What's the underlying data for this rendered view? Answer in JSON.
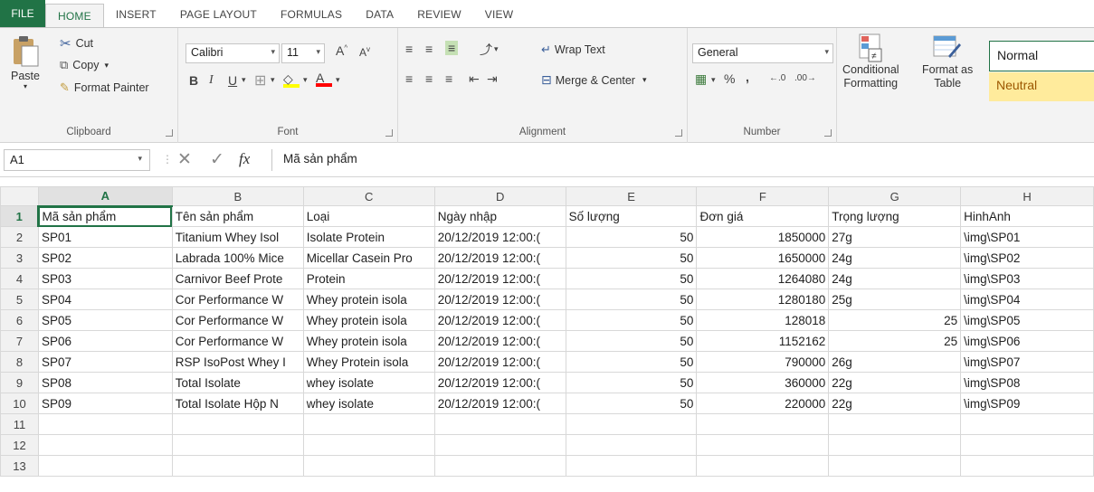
{
  "tabs": [
    "FILE",
    "HOME",
    "INSERT",
    "PAGE LAYOUT",
    "FORMULAS",
    "DATA",
    "REVIEW",
    "VIEW"
  ],
  "clipboard": {
    "paste": "Paste",
    "cut": "Cut",
    "copy": "Copy",
    "format_painter": "Format Painter",
    "label": "Clipboard"
  },
  "font": {
    "name": "Calibri",
    "size": "11",
    "bold": "B",
    "italic": "I",
    "underline": "U",
    "label": "Font"
  },
  "alignment": {
    "wrap": "Wrap Text",
    "merge": "Merge & Center",
    "label": "Alignment"
  },
  "number": {
    "format": "General",
    "percent": "%",
    "comma": ",",
    "label": "Number"
  },
  "styles": {
    "conditional_1": "Conditional",
    "conditional_2": "Formatting",
    "format_as_1": "Format as",
    "format_as_2": "Table",
    "normal": "Normal",
    "neutral": "Neutral"
  },
  "formula_bar": {
    "name_box": "A1",
    "fx": "fx",
    "content": "Mã sản phẩm"
  },
  "columns": [
    "A",
    "B",
    "C",
    "D",
    "E",
    "F",
    "G",
    "H"
  ],
  "rows": [
    {
      "n": "1",
      "cells": [
        "Mã sản phẩm",
        "Tên sản phẩm",
        "Loại",
        "Ngày nhập",
        "Số lượng",
        "Đơn giá",
        "Trọng lượng",
        "HinhAnh"
      ]
    },
    {
      "n": "2",
      "cells": [
        "SP01",
        "Titanium Whey Isol",
        "Isolate Protein",
        "20/12/2019 12:00:(",
        "50",
        "1850000",
        "27g",
        "\\img\\SP01"
      ]
    },
    {
      "n": "3",
      "cells": [
        "SP02",
        "Labrada 100% Mice",
        "Micellar Casein Pro",
        "20/12/2019 12:00:(",
        "50",
        "1650000",
        "24g",
        "\\img\\SP02"
      ]
    },
    {
      "n": "4",
      "cells": [
        "SP03",
        "Carnivor Beef Prote",
        "Protein",
        "20/12/2019 12:00:(",
        "50",
        "1264080",
        "24g",
        "\\img\\SP03"
      ]
    },
    {
      "n": "5",
      "cells": [
        "SP04",
        "Cor Performance W",
        "Whey protein isola",
        "20/12/2019 12:00:(",
        "50",
        "1280180",
        "25g",
        "\\img\\SP04"
      ]
    },
    {
      "n": "6",
      "cells": [
        "SP05",
        "Cor Performance W",
        "Whey protein isola",
        "20/12/2019 12:00:(",
        "50",
        "128018",
        "25",
        "\\img\\SP05"
      ]
    },
    {
      "n": "7",
      "cells": [
        "SP06",
        "Cor Performance W",
        "Whey protein isola",
        "20/12/2019 12:00:(",
        "50",
        "1152162",
        "25",
        "\\img\\SP06"
      ]
    },
    {
      "n": "8",
      "cells": [
        "SP07",
        "RSP IsoPost Whey I",
        "Whey Protein isola",
        "20/12/2019 12:00:(",
        "50",
        "790000",
        "26g",
        "\\img\\SP07"
      ]
    },
    {
      "n": "9",
      "cells": [
        "SP08",
        "Total Isolate",
        "whey isolate",
        "20/12/2019 12:00:(",
        "50",
        "360000",
        "22g",
        "\\img\\SP08"
      ]
    },
    {
      "n": "10",
      "cells": [
        "SP09",
        "Total Isolate Hộp N",
        "whey isolate",
        "20/12/2019 12:00:(",
        "50",
        "220000",
        "22g",
        "\\img\\SP09"
      ]
    },
    {
      "n": "11",
      "cells": [
        "",
        "",
        "",
        "",
        "",
        "",
        "",
        ""
      ]
    },
    {
      "n": "12",
      "cells": [
        "",
        "",
        "",
        "",
        "",
        "",
        "",
        ""
      ]
    },
    {
      "n": "13",
      "cells": [
        "",
        "",
        "",
        "",
        "",
        "",
        "",
        ""
      ]
    }
  ],
  "colors": {
    "accent": "#217346",
    "neutral_fill": "#ffeb9c",
    "neutral_text": "#9c5700"
  }
}
